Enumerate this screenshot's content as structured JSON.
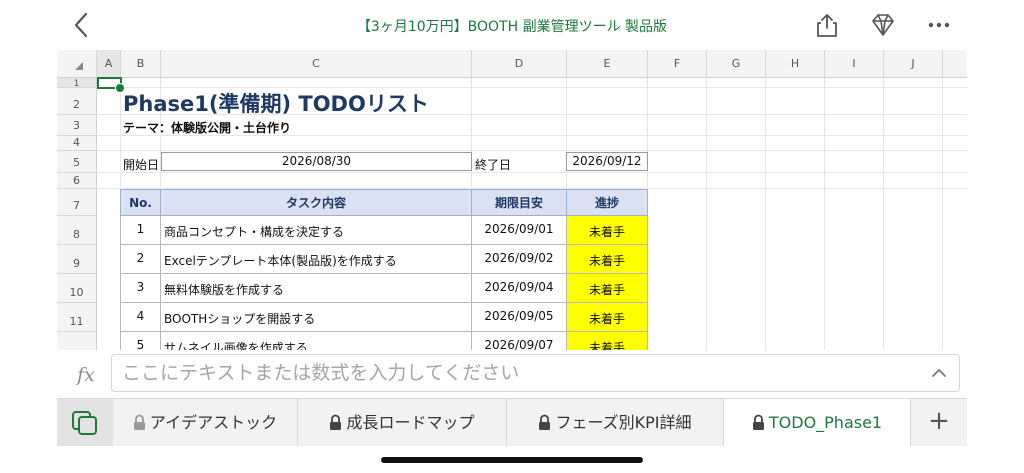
{
  "app": {
    "title": "【3ヶ月10万円】BOOTH 副業管理ツール 製品版",
    "accent": "#1e7a3c"
  },
  "toolbar": {
    "icons": [
      "back-icon",
      "share-icon",
      "diamond-icon",
      "more-icon"
    ]
  },
  "grid": {
    "columns": [
      "A",
      "B",
      "C",
      "D",
      "E",
      "F",
      "G",
      "H",
      "I",
      "J"
    ],
    "rows": [
      "1",
      "2",
      "3",
      "4",
      "5",
      "6",
      "7",
      "8",
      "9",
      "10",
      "11"
    ]
  },
  "sheet": {
    "heading": "Phase1(準備期) TODOリスト",
    "theme": "テーマ：体験版公開・土台作り",
    "start_label": "開始日",
    "start_date": "2026/08/30",
    "end_label": "終了日",
    "end_date": "2026/09/12",
    "table": {
      "headers": [
        "No.",
        "タスク内容",
        "期限目安",
        "進捗"
      ],
      "rows": [
        {
          "no": "1",
          "task": "商品コンセプト・構成を決定する",
          "due": "2026/09/01",
          "status": "未着手"
        },
        {
          "no": "2",
          "task": "Excelテンプレート本体(製品版)を作成する",
          "due": "2026/09/02",
          "status": "未着手"
        },
        {
          "no": "3",
          "task": "無料体験版を作成する",
          "due": "2026/09/04",
          "status": "未着手"
        },
        {
          "no": "4",
          "task": "BOOTHショップを開設する",
          "due": "2026/09/05",
          "status": "未着手"
        },
        {
          "no": "5",
          "task": "サムネイル画像を作成する",
          "due": "2026/09/07",
          "status": "未着手"
        }
      ],
      "header_color": "#d9e1f2",
      "status_color": "#ffff00"
    }
  },
  "formula_bar": {
    "label": "fx",
    "placeholder": "ここにテキストまたは数式を入力してください"
  },
  "tabs": [
    {
      "label": "アイデアストック",
      "locked": true,
      "active": false
    },
    {
      "label": "成長ロードマップ",
      "locked": true,
      "active": false
    },
    {
      "label": "フェーズ別KPI詳細",
      "locked": true,
      "active": false
    },
    {
      "label": "TODO_Phase1",
      "locked": true,
      "active": true
    }
  ],
  "tabs_add": "+"
}
